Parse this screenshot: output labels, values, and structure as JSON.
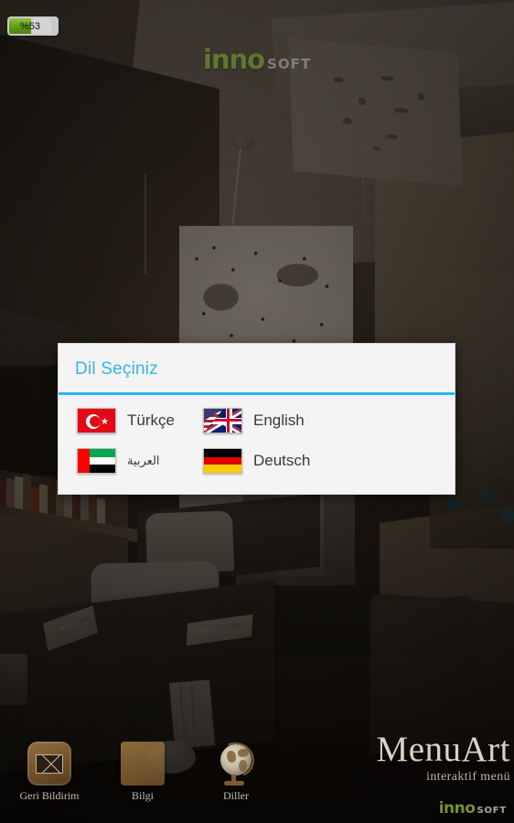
{
  "status_bar": {
    "battery_label": "%53",
    "battery_level_percent": 53,
    "battery_color": "#5e9c14"
  },
  "top_logo": {
    "primary": "inno",
    "secondary": "SOFT",
    "primary_color": "#7a9c2e",
    "secondary_color": "#a9a69c"
  },
  "dialog": {
    "title": "Dil Seçiniz",
    "title_color": "#33b5e5",
    "divider_color": "#2ab6ef",
    "background_color": "#f4f4f4",
    "languages": [
      {
        "label": "Türkçe",
        "flag": "turkey-flag",
        "code": "tr"
      },
      {
        "label": "English",
        "flag": "english-flag",
        "code": "en"
      },
      {
        "label": "العربية",
        "flag": "uae-flag",
        "code": "ar"
      },
      {
        "label": "Deutsch",
        "flag": "germany-flag",
        "code": "de"
      }
    ]
  },
  "bottom_bar": {
    "items": [
      {
        "label": "Geri Bildirim",
        "icon": "mail-icon"
      },
      {
        "label": "Bilgi",
        "icon": "picture-frame-icon"
      },
      {
        "label": "Diller",
        "icon": "globe-icon"
      }
    ]
  },
  "branding": {
    "name": "MenuArt",
    "tagline": "interaktif menü",
    "logo_primary": "inno",
    "logo_secondary": "SOFT"
  }
}
